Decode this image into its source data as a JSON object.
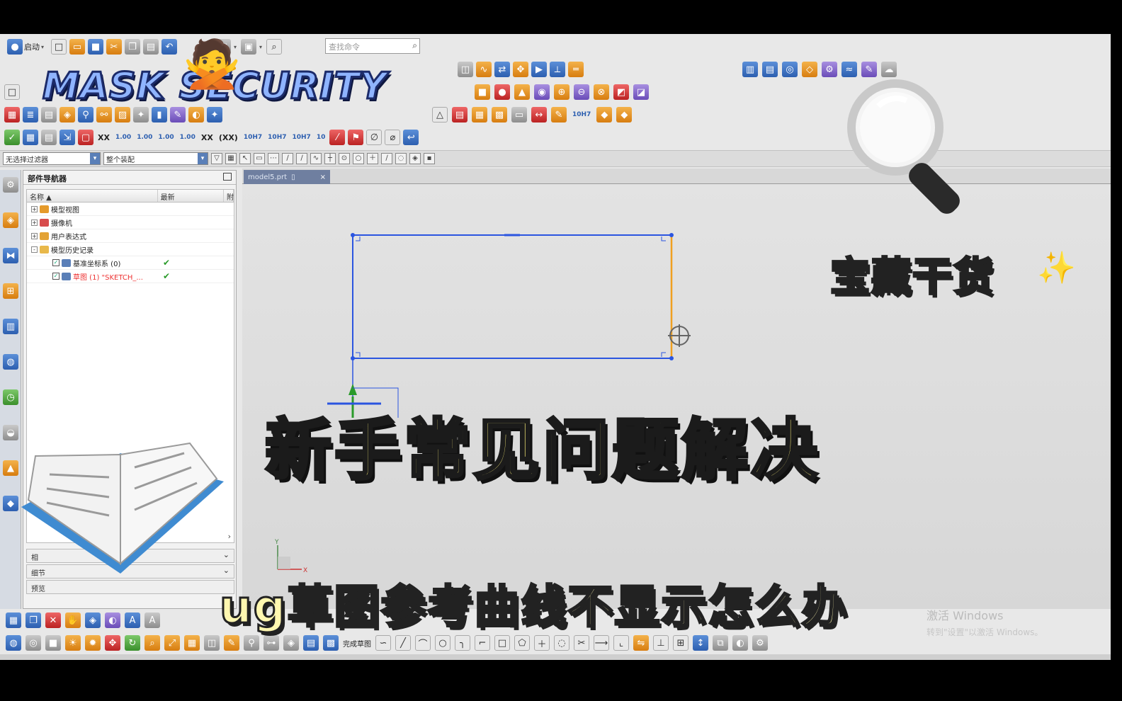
{
  "toolbar": {
    "start_label": "启动",
    "search_placeholder": "查找命令",
    "dim_labels": [
      "XX",
      "1.00",
      "1.00",
      "1.00",
      "1.00",
      "XX",
      "(XX)",
      "10H7",
      "10H7",
      "10H7",
      "10"
    ]
  },
  "selection_bar": {
    "filter_value": "无选择过滤器",
    "scope_value": "整个装配"
  },
  "navigator": {
    "title": "部件导航器",
    "columns": [
      "名称",
      "最新",
      "附"
    ],
    "rows": [
      {
        "label": "模型视图",
        "latest": "",
        "checked": false,
        "icon": "view-icon",
        "expand": "+"
      },
      {
        "label": "摄像机",
        "latest": "",
        "checked": false,
        "icon": "camera-icon",
        "expand": "+"
      },
      {
        "label": "用户表达式",
        "latest": "",
        "checked": false,
        "icon": "expression-icon",
        "expand": "+"
      },
      {
        "label": "模型历史记录",
        "latest": "",
        "checked": false,
        "icon": "folder-icon",
        "expand": "-"
      },
      {
        "label": "基准坐标系 (0)",
        "latest": "✔",
        "checked": true,
        "icon": "datum-csys-icon",
        "expand": ""
      },
      {
        "label": "草图 (1) \"SKETCH_...",
        "latest": "✔",
        "checked": true,
        "icon": "sketch-icon",
        "expand": ""
      }
    ],
    "bottom_panels": [
      "相",
      "细节",
      "预览"
    ]
  },
  "graphics": {
    "tab_label": "model5.prt",
    "sketch_color": "#2b55e0",
    "highlight_color": "#f0a020"
  },
  "bottom_toolbar": {
    "finish_sketch_label": "完成草图"
  },
  "windows_activation": {
    "title": "激活 Windows",
    "subtitle": "转到\"设置\"以激活 Windows。"
  },
  "overlay": {
    "brand": "MASK SECURITY",
    "treasure": "宝藏干货",
    "headline": "新手常见问题解决",
    "subline": "ug草图参考曲线不显示怎么办"
  }
}
